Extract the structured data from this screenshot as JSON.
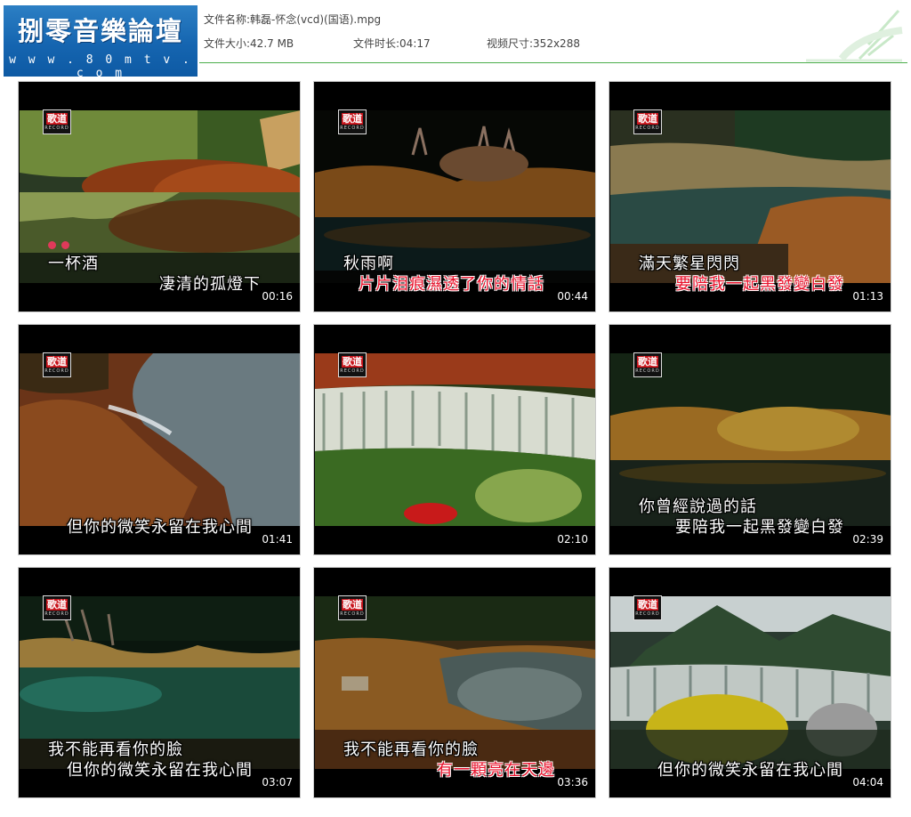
{
  "logo": {
    "title": "捌零音樂論壇",
    "url": "w w w . 8 0 m t v . c o m"
  },
  "file_info": {
    "name_label": "文件名称:",
    "name_value": "韩磊-怀念(vcd)(国语).mpg",
    "size_label": "文件大小:",
    "size_value": "42.7 MB",
    "duration_label": "文件时长:",
    "duration_value": "04:17",
    "dims_label": "视频尺寸:",
    "dims_value": "352x288"
  },
  "badge": {
    "text": "歌道",
    "sub": "RECORD"
  },
  "colors": {
    "header_line": "#4cae4c",
    "logo_bg": "#1565b0",
    "lyric_highlight": "#e8102a"
  },
  "thumbnails": [
    {
      "time": "00:16",
      "lyric1": "一杯酒",
      "lyric2": "凄清的孤燈下",
      "lyric2_highlight": false
    },
    {
      "time": "00:44",
      "lyric1": "秋雨啊",
      "lyric2": "片片泪痕濕透了你的情話",
      "lyric2_highlight": true
    },
    {
      "time": "01:13",
      "lyric1": "滿天繁星閃閃",
      "lyric2": "要陪我一起黑發變白發",
      "lyric2_highlight": true
    },
    {
      "time": "01:41",
      "lyric1": "",
      "lyric2": "但你的微笑永留在我心間",
      "lyric2_highlight": false
    },
    {
      "time": "02:10",
      "lyric1": "",
      "lyric2": "",
      "lyric2_highlight": false
    },
    {
      "time": "02:39",
      "lyric1": "你曾經說過的話",
      "lyric2": "要陪我一起黑發變白發",
      "lyric2_highlight": false
    },
    {
      "time": "03:07",
      "lyric1": "我不能再看你的臉",
      "lyric2": "但你的微笑永留在我心間",
      "lyric2_highlight": false
    },
    {
      "time": "03:36",
      "lyric1": "我不能再看你的臉",
      "lyric2": "有一顆亮在天邊",
      "lyric2_highlight": true
    },
    {
      "time": "04:04",
      "lyric1": "",
      "lyric2": "但你的微笑永留在我心間",
      "lyric2_highlight": false
    }
  ]
}
